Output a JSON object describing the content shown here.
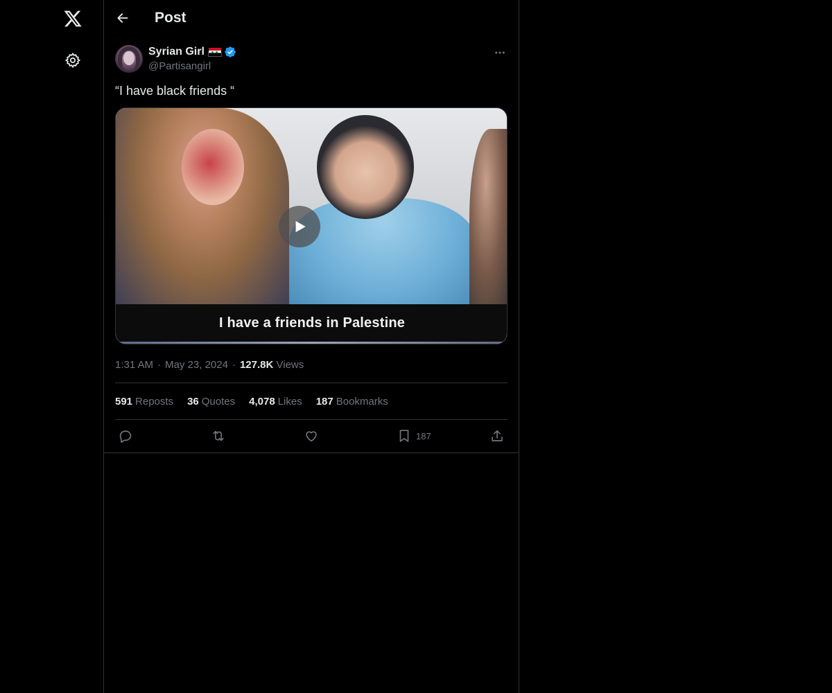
{
  "header": {
    "title": "Post"
  },
  "post": {
    "display_name": "Syrian Girl",
    "handle": "@Partisangirl",
    "text": "“I have black friends “",
    "media": {
      "caption": "I have a friends in Palestine"
    },
    "time": "1:31 AM",
    "separator": "·",
    "date": "May 23, 2024",
    "views_count": "127.8K",
    "views_label": "Views"
  },
  "stats": {
    "reposts": {
      "count": "591",
      "label": "Reposts"
    },
    "quotes": {
      "count": "36",
      "label": "Quotes"
    },
    "likes": {
      "count": "4,078",
      "label": "Likes"
    },
    "bookmarks": {
      "count": "187",
      "label": "Bookmarks"
    }
  },
  "actions": {
    "bookmark_count": "187"
  },
  "icons": {
    "logo": "x-logo-icon",
    "settings": "gear-icon",
    "back": "arrow-left-icon",
    "more": "more-dots-icon",
    "verified": "verified-badge-icon",
    "play": "play-icon",
    "reply": "reply-icon",
    "repost": "repost-icon",
    "like": "heart-icon",
    "bookmark": "bookmark-icon",
    "share": "share-icon"
  },
  "colors": {
    "background": "#000000",
    "text_primary": "#e7e9ea",
    "text_secondary": "#71767b",
    "border": "#2f3336",
    "verified": "#1d9bf0"
  }
}
